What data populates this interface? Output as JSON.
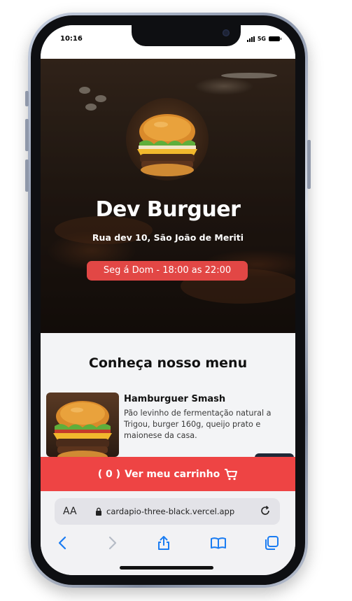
{
  "status_bar": {
    "time": "10:16",
    "network": "5G"
  },
  "restaurant": {
    "name": "Dev Burguer",
    "address": "Rua dev 10, São João de Meriti",
    "hours": "Seg á Dom - 18:00 as 22:00",
    "logo_icon": "burger-image"
  },
  "menu": {
    "title": "Conheça nosso menu",
    "items": [
      {
        "name": "Hamburguer Smash",
        "description": "Pão levinho de fermentação natural a Trigou, burger 160g, queijo prato e maionese da casa.",
        "image_icon": "burger-image"
      }
    ]
  },
  "cart": {
    "count": "( 0 )",
    "label": "Ver meu carrinho",
    "icon": "cart-plus-icon"
  },
  "browser": {
    "text_size_label": "AA",
    "url": "cardapio-three-black.vercel.app",
    "icons": [
      "lock-icon",
      "reload-icon",
      "back-icon",
      "forward-icon",
      "share-icon",
      "bookmarks-icon",
      "tabs-icon"
    ]
  },
  "colors": {
    "accent_red": "#ee4444",
    "hours_badge": "#e24745",
    "menu_background": "#f3f4f6",
    "safari_blue": "#1a7cf2"
  }
}
